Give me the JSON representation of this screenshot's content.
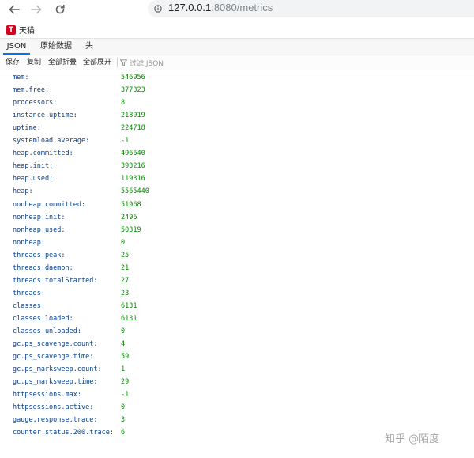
{
  "browser": {
    "url_host": "127.0.0.1",
    "url_rest": ":8080/metrics"
  },
  "bookmarks": [
    {
      "label": "天猫",
      "icon": "tmall-icon"
    }
  ],
  "tabs": [
    {
      "label": "JSON",
      "active": true
    },
    {
      "label": "原始数据",
      "active": false
    },
    {
      "label": "头",
      "active": false
    }
  ],
  "toolbar": {
    "save": "保存",
    "copy": "复制",
    "collapse_all": "全部折叠",
    "expand_all": "全部展开",
    "filter_placeholder": "过滤 JSON"
  },
  "metrics": [
    {
      "key": "mem:",
      "value": "546956"
    },
    {
      "key": "mem.free:",
      "value": "377323"
    },
    {
      "key": "processors:",
      "value": "8"
    },
    {
      "key": "instance.uptime:",
      "value": "218919"
    },
    {
      "key": "uptime:",
      "value": "224718"
    },
    {
      "key": "systemload.average:",
      "value": "-1"
    },
    {
      "key": "heap.committed:",
      "value": "496640"
    },
    {
      "key": "heap.init:",
      "value": "393216"
    },
    {
      "key": "heap.used:",
      "value": "119316"
    },
    {
      "key": "heap:",
      "value": "5565440"
    },
    {
      "key": "nonheap.committed:",
      "value": "51968"
    },
    {
      "key": "nonheap.init:",
      "value": "2496"
    },
    {
      "key": "nonheap.used:",
      "value": "50319"
    },
    {
      "key": "nonheap:",
      "value": "0"
    },
    {
      "key": "threads.peak:",
      "value": "25"
    },
    {
      "key": "threads.daemon:",
      "value": "21"
    },
    {
      "key": "threads.totalStarted:",
      "value": "27"
    },
    {
      "key": "threads:",
      "value": "23"
    },
    {
      "key": "classes:",
      "value": "6131"
    },
    {
      "key": "classes.loaded:",
      "value": "6131"
    },
    {
      "key": "classes.unloaded:",
      "value": "0"
    },
    {
      "key": "gc.ps_scavenge.count:",
      "value": "4"
    },
    {
      "key": "gc.ps_scavenge.time:",
      "value": "59"
    },
    {
      "key": "gc.ps_marksweep.count:",
      "value": "1"
    },
    {
      "key": "gc.ps_marksweep.time:",
      "value": "29"
    },
    {
      "key": "httpsessions.max:",
      "value": "-1"
    },
    {
      "key": "httpsessions.active:",
      "value": "0"
    },
    {
      "key": "gauge.response.trace:",
      "value": "3"
    },
    {
      "key": "counter.status.200.trace:",
      "value": "6"
    }
  ],
  "watermark": "知乎 @陌度"
}
